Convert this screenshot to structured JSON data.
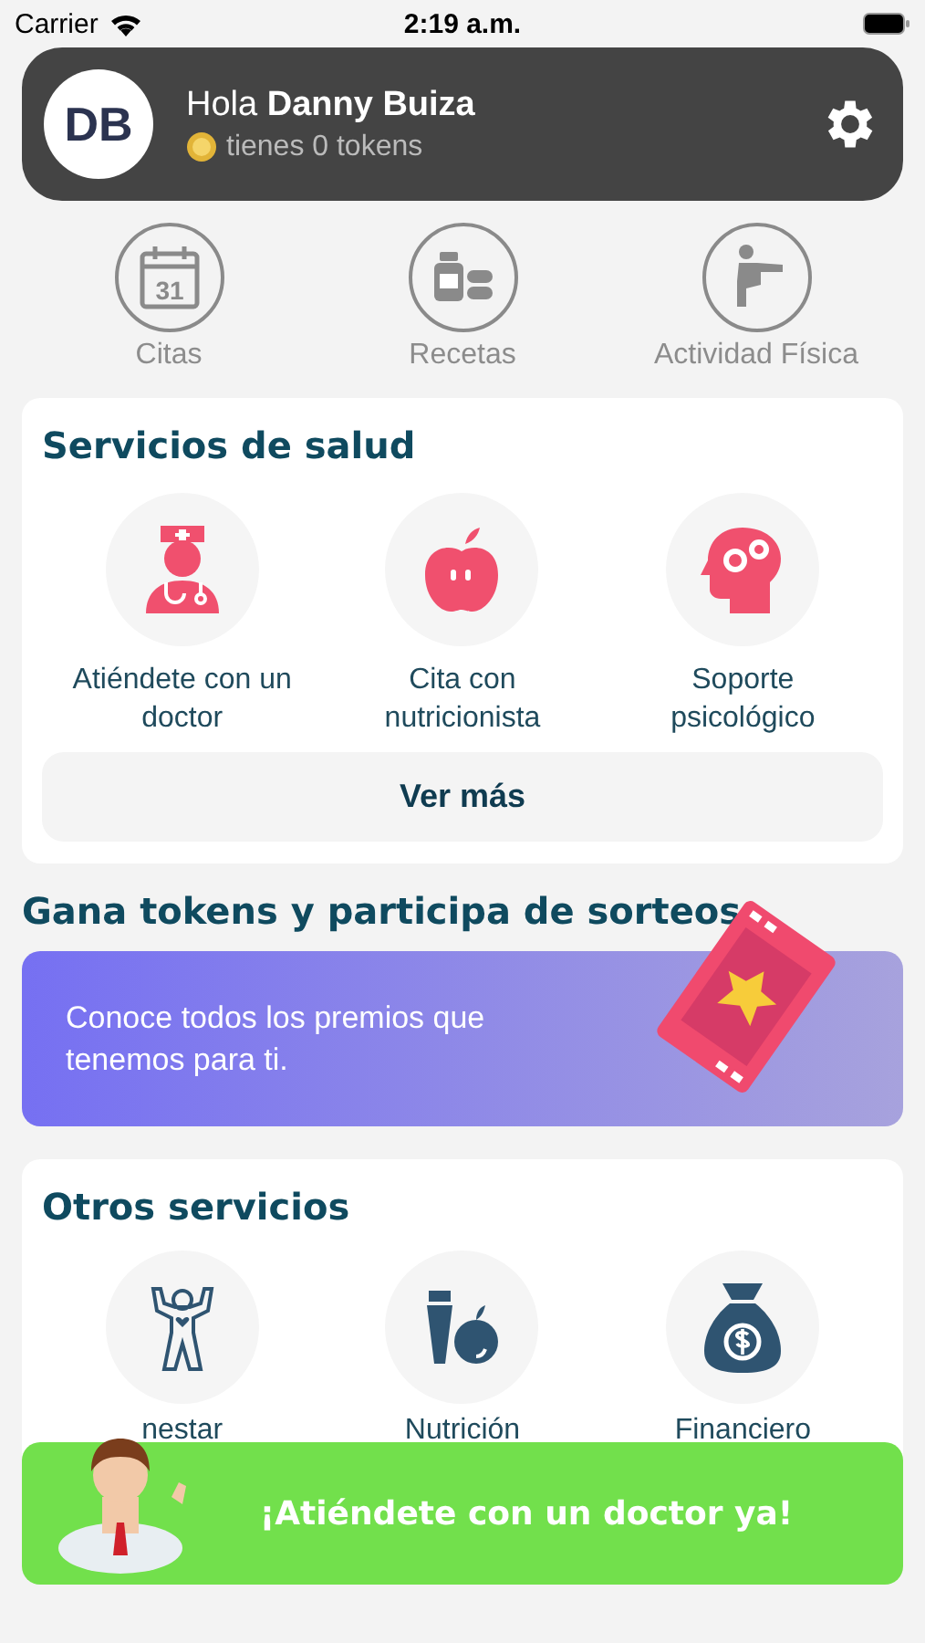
{
  "status_bar": {
    "carrier": "Carrier",
    "time": "2:19 a.m."
  },
  "header": {
    "initials": "DB",
    "greeting": "Hola **Danny Buiza**",
    "tokens": "tienes 0 tokens"
  },
  "quick_links": [
    {
      "label": "Citas",
      "kind": "calendar",
      "calendar_day": "31"
    },
    {
      "label": "Recetas",
      "kind": "medicine"
    },
    {
      "label": "Actividad Física",
      "kind": "exercise"
    }
  ],
  "health_services": {
    "title": "Servicios de salud",
    "items": [
      {
        "label": "Atiéndete con un doctor",
        "kind": "doctor"
      },
      {
        "label": "Cita con nutricionista",
        "kind": "apple"
      },
      {
        "label": "Soporte psicológico",
        "kind": "head"
      }
    ],
    "more_button": "Ver más"
  },
  "rewards": {
    "title": "Gana tokens y participa de sorteos",
    "text": "Conoce todos los premios que tenemos para ti."
  },
  "other_services": {
    "title": "Otros servicios",
    "items": [
      {
        "label": "nestar",
        "kind": "wellness"
      },
      {
        "label": "Nutrición",
        "kind": "nutrition"
      },
      {
        "label": "Financiero",
        "kind": "money"
      }
    ]
  },
  "cta": {
    "label": "¡Atiéndete con un doctor ya!"
  }
}
